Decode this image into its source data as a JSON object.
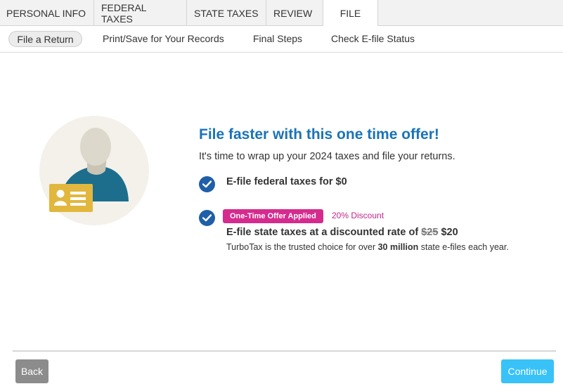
{
  "tabs": [
    {
      "label": "PERSONAL INFO"
    },
    {
      "label": "FEDERAL TAXES"
    },
    {
      "label": "STATE TAXES"
    },
    {
      "label": "REVIEW"
    },
    {
      "label": "FILE",
      "active": true
    }
  ],
  "subnav": [
    {
      "label": "File a Return",
      "selected": true
    },
    {
      "label": "Print/Save for Your Records"
    },
    {
      "label": "Final Steps"
    },
    {
      "label": "Check E-file Status"
    }
  ],
  "offer": {
    "headline": "File faster with this one time offer!",
    "intro": "It's time to wrap up your 2024 taxes and file your returns.",
    "item1": "E-file federal taxes for $0",
    "badge": "One-Time Offer Applied",
    "discount": "20% Discount",
    "item2_prefix": "E-file state taxes at a discounted rate of ",
    "item2_old_price": "$25",
    "item2_new_price": "$20",
    "tagline_prefix": "TurboTax is the trusted choice for over ",
    "tagline_bold": "30 million",
    "tagline_suffix": " state e-files each year."
  },
  "footer": {
    "back_label": "Back",
    "continue_label": "Continue"
  },
  "colors": {
    "headline": "#1a73b8",
    "check": "#1f5ea8",
    "badge": "#d52b8e",
    "continue": "#38c2f7",
    "back": "#8c8c8c"
  },
  "icons": {
    "avatar": "person-id-card-icon",
    "check": "checkmark-circle-icon"
  }
}
